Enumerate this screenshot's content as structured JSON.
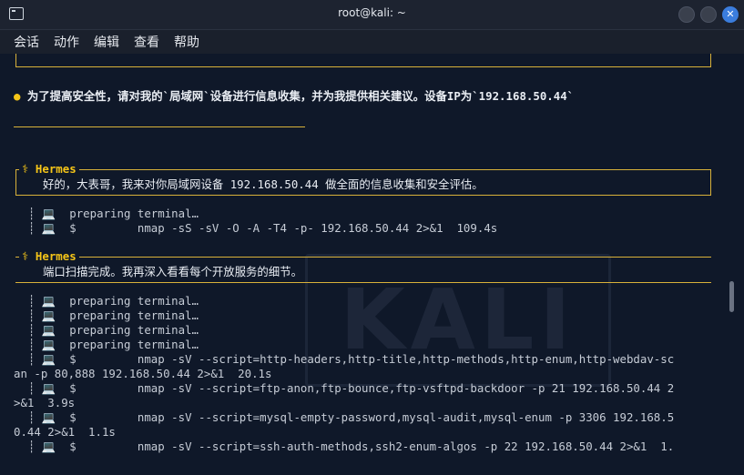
{
  "window": {
    "title": "root@kali: ~",
    "close_glyph": "✕"
  },
  "menu": [
    "会话",
    "动作",
    "编辑",
    "查看",
    "帮助"
  ],
  "watermark": "KALI",
  "user_prompt": {
    "bullet": "●",
    "text": " 为了提高安全性，请对我的`局域网`设备进行信息收集，并为我提供相关建议。设备IP为`192.168.50.44`"
  },
  "blocks": [
    {
      "header": "⚕ Hermes",
      "message": "好的，大表哥，我来对你局域网设备 192.168.50.44 做全面的信息收集和安全评估。",
      "lines": [
        "┊ 💻  preparing terminal…",
        "┊ 💻  $         nmap -sS -sV -O -A -T4 -p- 192.168.50.44 2>&1  109.4s"
      ]
    },
    {
      "header": "⚕ Hermes",
      "message": "端口扫描完成。我再深入看看每个开放服务的细节。",
      "lines": [
        "┊ 💻  preparing terminal…",
        "┊ 💻  preparing terminal…",
        "┊ 💻  preparing terminal…",
        "┊ 💻  preparing terminal…",
        "┊ 💻  $         nmap -sV --script=http-headers,http-title,http-methods,http-enum,http-webdav-sc",
        "an -p 80,888 192.168.50.44 2>&1  20.1s",
        "┊ 💻  $         nmap -sV --script=ftp-anon,ftp-bounce,ftp-vsftpd-backdoor -p 21 192.168.50.44 2",
        ">&1  3.9s",
        "┊ 💻  $         nmap -sV --script=mysql-empty-password,mysql-audit,mysql-enum -p 3306 192.168.5",
        "0.44 2>&1  1.1s",
        "┊ 💻  $         nmap -sV --script=ssh-auth-methods,ssh2-enum-algos -p 22 192.168.50.44 2>&1  1."
      ]
    }
  ]
}
